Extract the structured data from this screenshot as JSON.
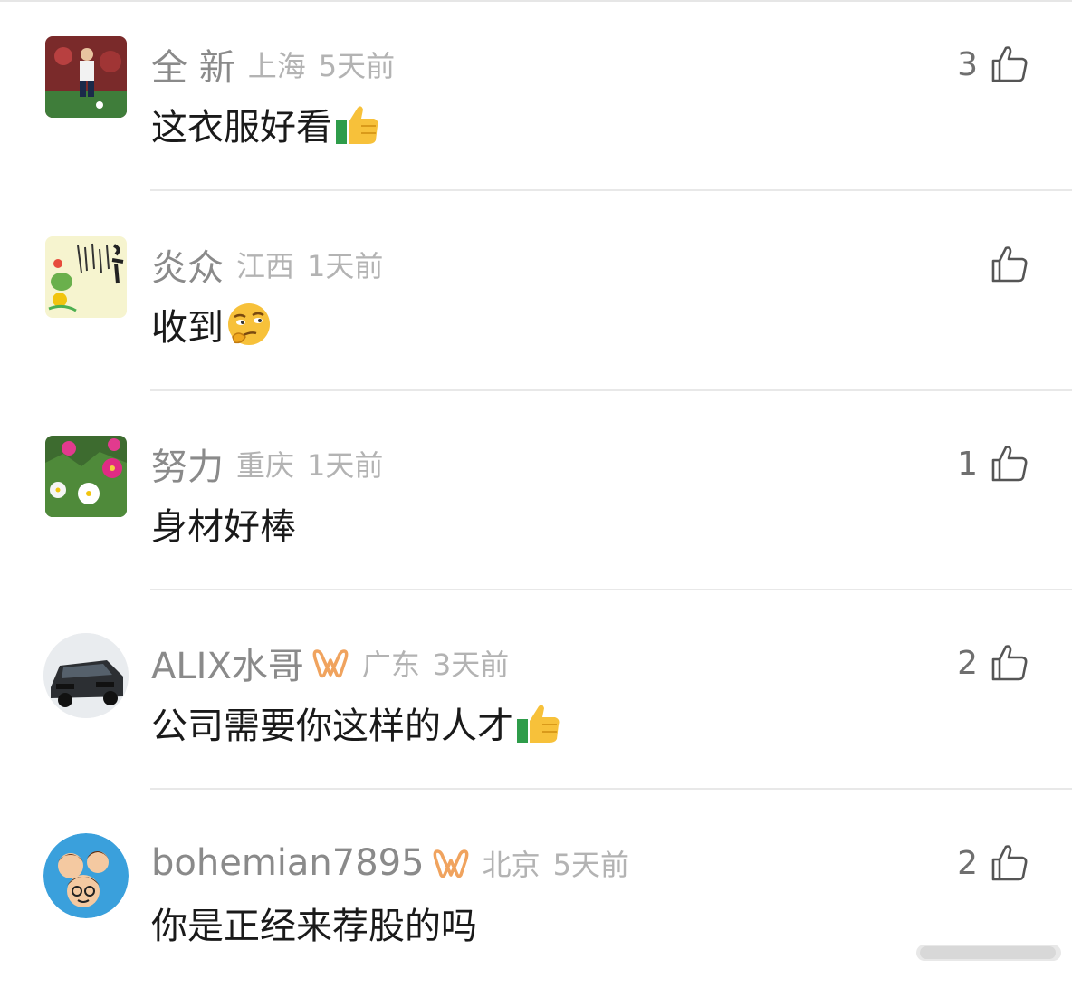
{
  "comments": [
    {
      "name": "全 新",
      "location": "上海",
      "time": "5天前",
      "text": "这衣服好看",
      "emoji": "thumbs-up-emoji",
      "likes": "3",
      "vip": false,
      "avatar": "soccer-player-avatar"
    },
    {
      "name": "炎众",
      "location": "江西",
      "time": "1天前",
      "text": "收到",
      "emoji": "thinking-emoji",
      "likes": "",
      "vip": false,
      "avatar": "calligraphy-avatar"
    },
    {
      "name": "努力",
      "location": "重庆",
      "time": "1天前",
      "text": "身材好棒",
      "emoji": "",
      "likes": "1",
      "vip": false,
      "avatar": "flowers-avatar"
    },
    {
      "name": "ALIX水哥",
      "location": "广东",
      "time": "3天前",
      "text": "公司需要你这样的人才",
      "emoji": "thumbs-up-emoji",
      "likes": "2",
      "vip": true,
      "avatar": "armored-car-avatar"
    },
    {
      "name": "bohemian7895",
      "location": "北京",
      "time": "5天前",
      "text": "你是正经来荐股的吗",
      "emoji": "",
      "likes": "2",
      "vip": true,
      "avatar": "cartoon-family-avatar"
    }
  ],
  "colors": {
    "vip_badge": "#f0a35e",
    "like_icon": "#555555",
    "name": "#8a8a8a",
    "meta": "#b3b3b3"
  }
}
